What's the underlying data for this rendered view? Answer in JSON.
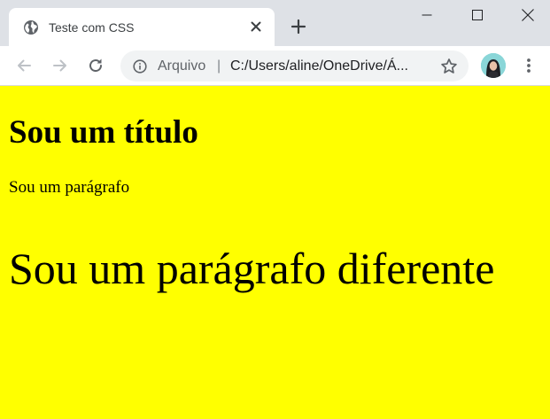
{
  "browser": {
    "tab": {
      "title": "Teste com CSS",
      "icon": "globe-icon"
    },
    "new_tab_icon": "plus-icon",
    "window_controls": [
      "minimize-icon",
      "maximize-icon",
      "close-icon"
    ],
    "toolbar": {
      "back_icon": "arrow-left-icon",
      "forward_icon": "arrow-right-icon",
      "reload_icon": "reload-icon",
      "security_icon": "info-icon",
      "security_label": "Arquivo",
      "separator": "|",
      "url": "C:/Users/aline/OneDrive/Á...",
      "bookmark_icon": "star-icon",
      "menu_icon": "kebab-menu-icon"
    }
  },
  "page": {
    "background_color": "#ffff00",
    "heading": "Sou um título",
    "paragraph": "Sou um parágrafo",
    "paragraph_different": "Sou um parágrafo diferente"
  }
}
